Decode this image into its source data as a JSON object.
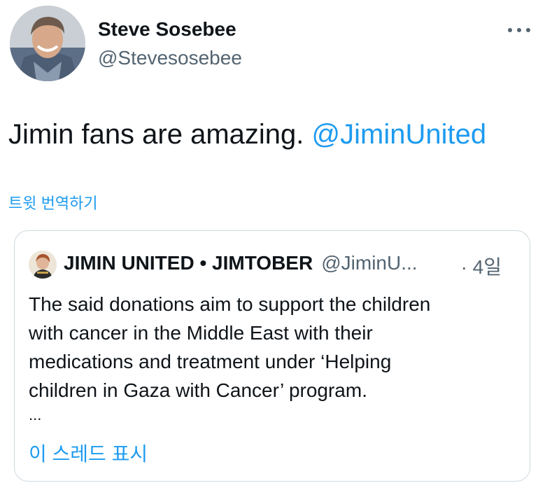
{
  "tweet": {
    "author": {
      "display_name": "Steve Sosebee",
      "handle": "@Stevesosebee"
    },
    "more_icon": "more-horizontal-icon",
    "text": "Jimin fans are amazing. ",
    "mention": "@JiminUnited",
    "translate_label": "트윗 번역하기"
  },
  "quoted_tweet": {
    "author": {
      "display_name": "JIMIN UNITED • JIMTOBER",
      "handle": "@JiminU..."
    },
    "time": "· 4일",
    "text_lines": [
      "The said donations aim to support the children",
      "with cancer in the Middle East with their",
      "medications and treatment under ‘Helping",
      "children in Gaza with Cancer’ program."
    ],
    "ellipsis": "...",
    "show_thread_label": "이 스레드 표시"
  },
  "colors": {
    "accent": "#1d9bf0",
    "text_primary": "#0f1419",
    "text_secondary": "#536471",
    "border": "#cfd9de"
  }
}
